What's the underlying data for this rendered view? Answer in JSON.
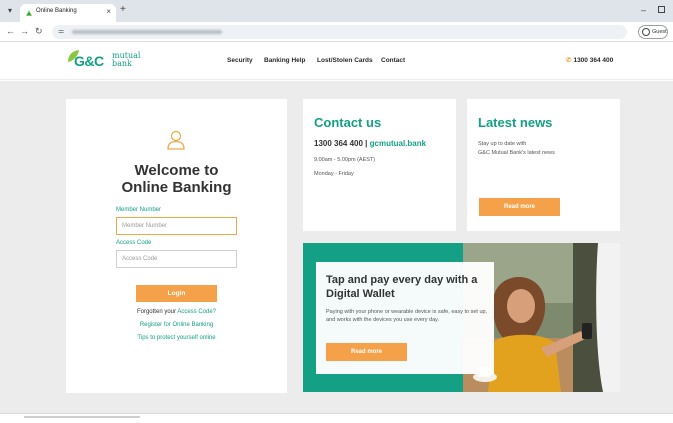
{
  "browser": {
    "tab_title": "Online Banking",
    "new_tab": "+",
    "close": "×",
    "guest_label": "Guest"
  },
  "header": {
    "logo": {
      "gc": "G&C",
      "mutual": "mutual",
      "bank": "bank"
    },
    "nav": [
      "Security",
      "Banking Help",
      "Lost/Stolen Cards",
      "Contact"
    ],
    "phone": "1300 364 400"
  },
  "login": {
    "welcome_line1": "Welcome to",
    "welcome_line2": "Online Banking",
    "member_label": "Member Number",
    "member_placeholder": "Member Number",
    "access_label": "Access Code",
    "access_placeholder": "Access Code",
    "login_button": "Login",
    "forgotten_prefix": "Forgotten your ",
    "forgotten_link": "Access Code?",
    "register_link": "Register for Online Banking",
    "tips_link": "Tips to protect yourself online"
  },
  "contact": {
    "heading": "Contact us",
    "phone": "1300 364 400",
    "separator": " | ",
    "site": "gcmutual.bank",
    "hours": "9.00am - 5.00pm (AEST)",
    "days": "Monday - Friday"
  },
  "news": {
    "heading": "Latest news",
    "line1": "Stay up to date with",
    "line2": "G&C Mutual Bank's latest news",
    "button": "Read more"
  },
  "promo": {
    "title": "Tap and pay every day with a Digital Wallet",
    "text": "Paying with your phone or wearable device is safe, easy to set up, and works with the devices you use every day.",
    "button": "Read more"
  },
  "colors": {
    "brand_green": "#14a085",
    "accent_orange": "#f5a14a"
  }
}
